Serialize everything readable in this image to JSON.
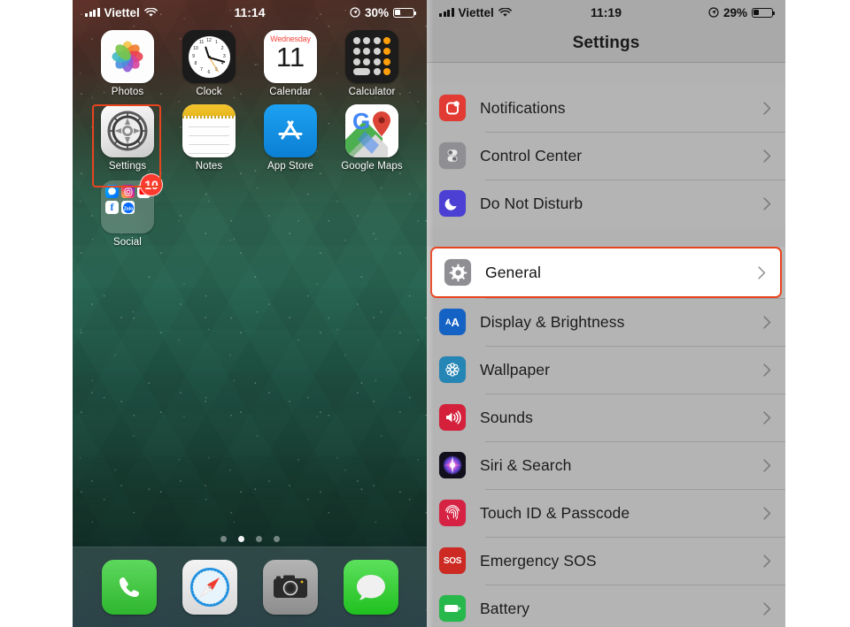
{
  "left_phone": {
    "status_bar": {
      "carrier": "Viettel",
      "signal_icon": "cellular-signal-icon",
      "wifi_icon": "wifi-icon",
      "time": "11:14",
      "location_icon": "location-services-icon",
      "battery_percent": "30%",
      "battery_icon": "battery-icon",
      "battery_level": 30
    },
    "apps": [
      {
        "label": "Photos",
        "icon": "photos-app-icon"
      },
      {
        "label": "Clock",
        "icon": "clock-app-icon"
      },
      {
        "label": "Calendar",
        "icon": "calendar-app-icon",
        "day_name": "Wednesday",
        "day_number": "11"
      },
      {
        "label": "Calculator",
        "icon": "calculator-app-icon"
      },
      {
        "label": "Settings",
        "icon": "settings-app-icon",
        "highlighted": true
      },
      {
        "label": "Notes",
        "icon": "notes-app-icon"
      },
      {
        "label": "App Store",
        "icon": "app-store-app-icon"
      },
      {
        "label": "Google Maps",
        "icon": "google-maps-app-icon"
      }
    ],
    "folder": {
      "label": "Social",
      "badge_count": "10",
      "mini_icons": [
        "messenger-icon",
        "instagram-icon",
        "youtube-icon",
        "facebook-icon",
        "zalo-icon"
      ]
    },
    "page_dots": {
      "count": 4,
      "active_index": 1
    },
    "dock": [
      {
        "label": "Phone",
        "icon": "phone-app-icon"
      },
      {
        "label": "Safari",
        "icon": "safari-app-icon"
      },
      {
        "label": "Camera",
        "icon": "camera-app-icon"
      },
      {
        "label": "Messages",
        "icon": "messages-app-icon"
      }
    ],
    "highlight_color": "#e8441f"
  },
  "right_phone": {
    "status_bar": {
      "carrier": "Viettel",
      "signal_icon": "cellular-signal-icon",
      "wifi_icon": "wifi-icon",
      "time": "11:19",
      "location_icon": "location-services-icon",
      "battery_percent": "29%",
      "battery_icon": "battery-icon",
      "battery_level": 29
    },
    "nav_title": "Settings",
    "highlight_color": "#e8441f",
    "groups": [
      {
        "rows": [
          {
            "label": "Notifications",
            "icon": "notifications-icon",
            "icon_color": "#e23b33",
            "chevron": "chevron-right-icon"
          },
          {
            "label": "Control Center",
            "icon": "control-center-icon",
            "icon_color": "#8e8e93",
            "chevron": "chevron-right-icon"
          },
          {
            "label": "Do Not Disturb",
            "icon": "do-not-disturb-icon",
            "icon_color": "#4b3fd4",
            "chevron": "chevron-right-icon"
          }
        ]
      },
      {
        "rows": [
          {
            "label": "General",
            "icon": "general-gear-icon",
            "icon_color": "#8e8e93",
            "chevron": "chevron-right-icon",
            "highlighted": true
          },
          {
            "label": "Display & Brightness",
            "icon": "display-brightness-icon",
            "icon_color": "#1462c4",
            "chevron": "chevron-right-icon"
          },
          {
            "label": "Wallpaper",
            "icon": "wallpaper-icon",
            "icon_color": "#2585b5",
            "chevron": "chevron-right-icon"
          },
          {
            "label": "Sounds",
            "icon": "sounds-icon",
            "icon_color": "#d5203b",
            "chevron": "chevron-right-icon"
          },
          {
            "label": "Siri & Search",
            "icon": "siri-search-icon",
            "icon_color": "#17131f",
            "chevron": "chevron-right-icon"
          },
          {
            "label": "Touch ID & Passcode",
            "icon": "touch-id-icon",
            "icon_color": "#d62343",
            "chevron": "chevron-right-icon"
          },
          {
            "label": "Emergency SOS",
            "icon": "emergency-sos-icon",
            "icon_color": "#cc2a22",
            "chevron": "chevron-right-icon",
            "glyph": "SOS"
          },
          {
            "label": "Battery",
            "icon": "battery-settings-icon",
            "icon_color": "#27b84c",
            "chevron": "chevron-right-icon"
          }
        ]
      }
    ]
  }
}
